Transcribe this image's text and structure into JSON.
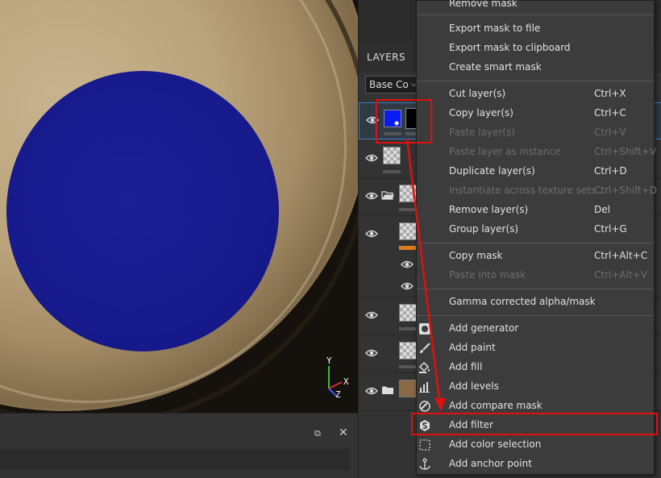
{
  "viewport": {
    "gizmo_labels": [
      "Y",
      "X",
      "Z"
    ]
  },
  "bottom_panel": {
    "restore_glyph": "⧉",
    "close_glyph": "✕"
  },
  "layers_panel": {
    "title": "LAYERS",
    "blend_mode": "Base Co",
    "blend_chevron": "⌵",
    "colors": {
      "blue_fill": "#0a1cf5",
      "orange_bar": "#e07b20"
    }
  },
  "context_menu": {
    "items": [
      {
        "label": "Remove mask",
        "shortcut": "",
        "disabled": false
      },
      {
        "label": "Export mask to file",
        "shortcut": "",
        "disabled": false
      },
      {
        "label": "Export mask to clipboard",
        "shortcut": "",
        "disabled": false
      },
      {
        "label": "Create smart mask",
        "shortcut": "",
        "disabled": false
      },
      {
        "label": "Cut layer(s)",
        "shortcut": "Ctrl+X",
        "disabled": false
      },
      {
        "label": "Copy layer(s)",
        "shortcut": "Ctrl+C",
        "disabled": false
      },
      {
        "label": "Paste layer(s)",
        "shortcut": "Ctrl+V",
        "disabled": true
      },
      {
        "label": "Paste layer as instance",
        "shortcut": "Ctrl+Shift+V",
        "disabled": true
      },
      {
        "label": "Duplicate layer(s)",
        "shortcut": "Ctrl+D",
        "disabled": false
      },
      {
        "label": "Instantiate across texture sets...",
        "shortcut": "Ctrl+Shift+D",
        "disabled": true
      },
      {
        "label": "Remove layer(s)",
        "shortcut": "Del",
        "disabled": false
      },
      {
        "label": "Group layer(s)",
        "shortcut": "Ctrl+G",
        "disabled": false
      },
      {
        "label": "Copy mask",
        "shortcut": "Ctrl+Alt+C",
        "disabled": false
      },
      {
        "label": "Paste into mask",
        "shortcut": "Ctrl+Alt+V",
        "disabled": true
      },
      {
        "label": "Gamma corrected alpha/mask",
        "shortcut": "",
        "disabled": false
      },
      {
        "label": "Add generator",
        "shortcut": "",
        "disabled": false,
        "icon": "generator-icon"
      },
      {
        "label": "Add paint",
        "shortcut": "",
        "disabled": false,
        "icon": "brush-icon"
      },
      {
        "label": "Add fill",
        "shortcut": "",
        "disabled": false,
        "icon": "paint-bucket-icon"
      },
      {
        "label": "Add levels",
        "shortcut": "",
        "disabled": false,
        "icon": "levels-icon"
      },
      {
        "label": "Add compare mask",
        "shortcut": "",
        "disabled": false,
        "icon": "compare-mask-icon"
      },
      {
        "label": "Add filter",
        "shortcut": "",
        "disabled": false,
        "icon": "filter-icon"
      },
      {
        "label": "Add color selection",
        "shortcut": "",
        "disabled": false,
        "icon": "color-selection-icon"
      },
      {
        "label": "Add anchor point",
        "shortcut": "",
        "disabled": false,
        "icon": "anchor-icon"
      }
    ]
  },
  "annotation_color": "#e01010"
}
